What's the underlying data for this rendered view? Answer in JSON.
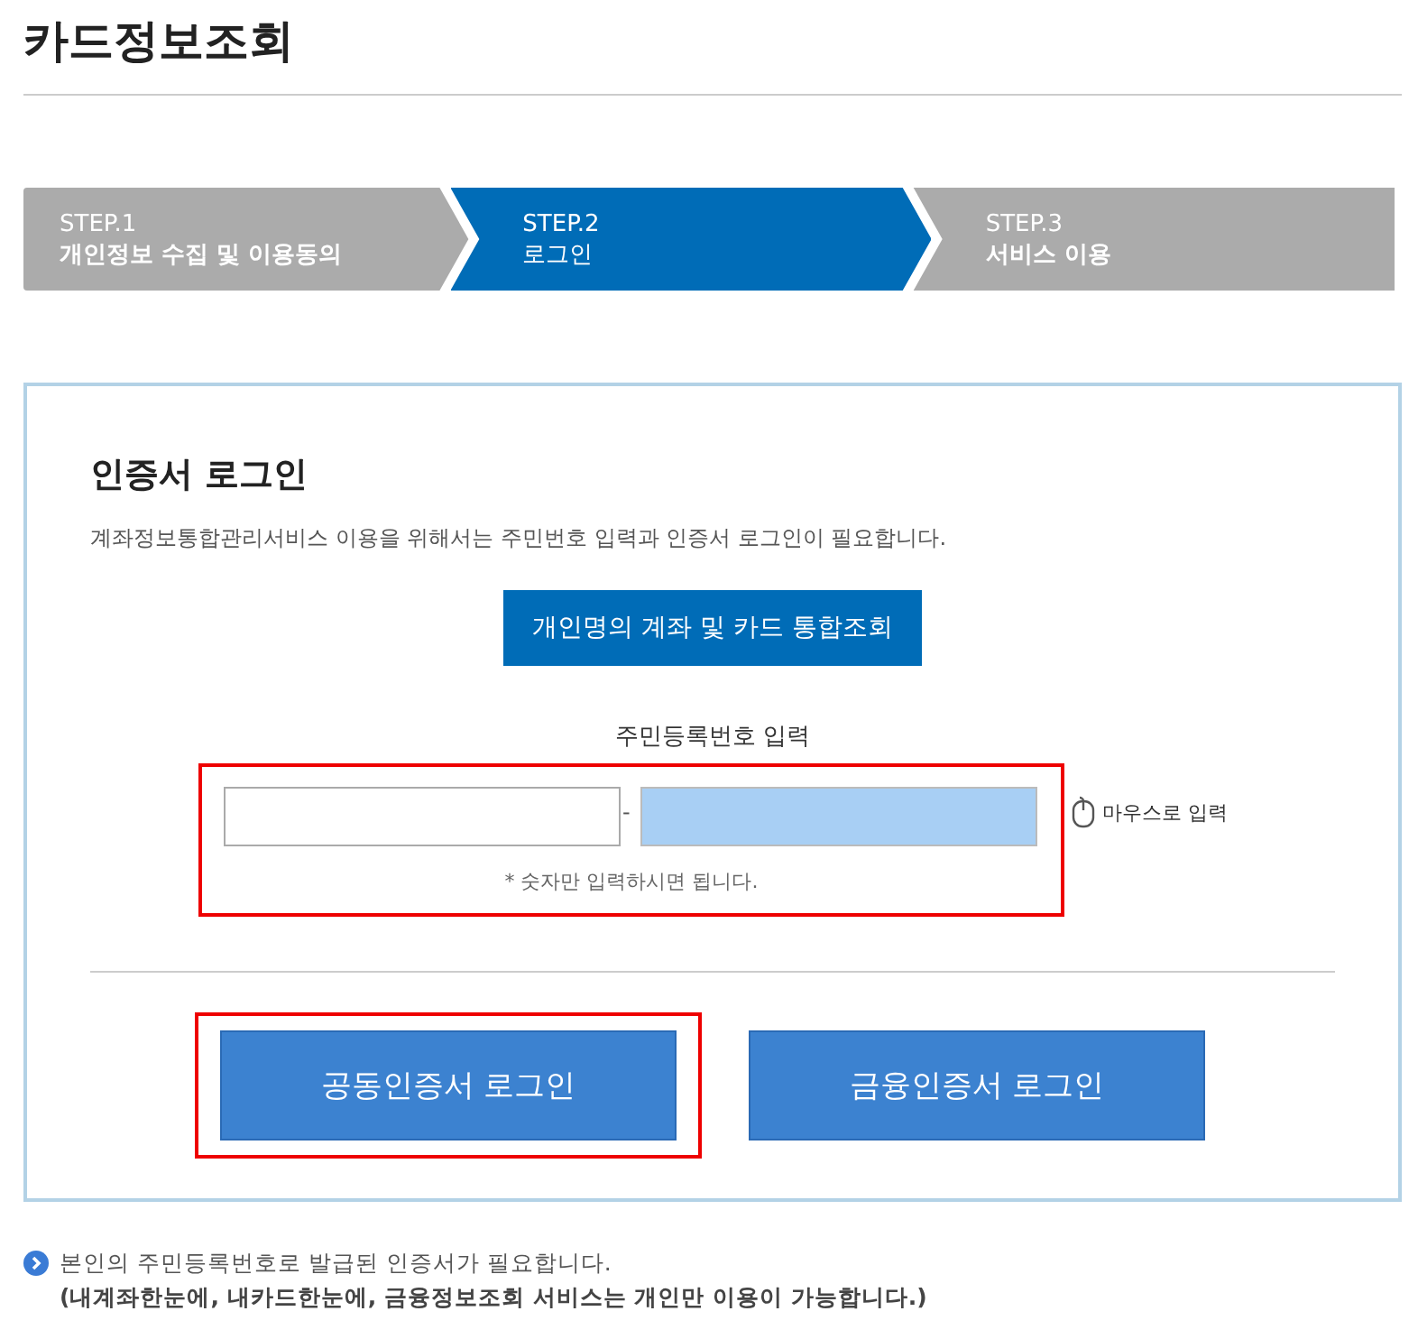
{
  "page_title": "카드정보조회",
  "steps": [
    {
      "number": "STEP.1",
      "label": "개인정보 수집 및 이용동의",
      "selected": false
    },
    {
      "number": "STEP.2",
      "label": "로그인",
      "selected": true
    },
    {
      "number": "STEP.3",
      "label": "서비스 이용",
      "selected": false
    }
  ],
  "login": {
    "heading": "인증서 로그인",
    "description": "계좌정보통합관리서비스 이용을 위해서는 주민번호 입력과 인증서 로그인이 필요합니다.",
    "lookup_button": "개인명의 계좌 및 카드 통합조회",
    "rrn": {
      "label": "주민등록번호 입력",
      "highlighted": true,
      "separator": "-",
      "fields": [
        {
          "filled": false
        },
        {
          "filled": true
        }
      ],
      "mouse_input": "마우스로 입력",
      "hint": "* 숫자만 입력하시면 됩니다."
    },
    "buttons": [
      {
        "label": "공동인증서 로그인",
        "highlighted": true
      },
      {
        "label": "금융인증서 로그인",
        "highlighted": false
      }
    ]
  },
  "notes": [
    {
      "text": "본인의 주민등록번호로 발급된 인증서가 필요합니다.",
      "bold": false
    },
    {
      "text": "(내계좌한눈에, 내카드한눈에, 금융정보조회 서비스는 개인만 이용이 가능합니다.)",
      "bold": true
    }
  ]
}
